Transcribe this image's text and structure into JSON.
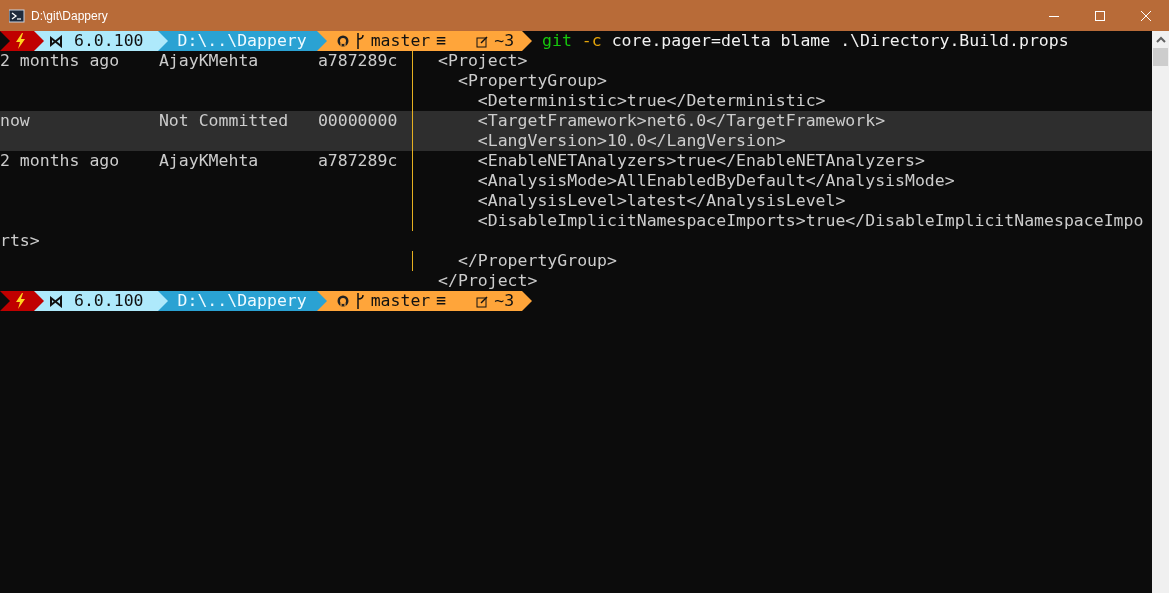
{
  "window": {
    "title": "D:\\git\\Dappery"
  },
  "command_prompt": {
    "segments": [
      {
        "kind": "status"
      },
      {
        "kind": "dotnet",
        "text": "6.0.100"
      },
      {
        "kind": "path",
        "text": "D:\\..\\Dappery"
      },
      {
        "kind": "git",
        "branch": "master",
        "status": "≡",
        "changes": "~3"
      }
    ],
    "command": [
      {
        "kind": "program",
        "text": "git"
      },
      {
        "kind": "flag",
        "text": "-c"
      },
      {
        "kind": "arg",
        "text": "core.pager=delta blame .\\Directory.Build.props"
      }
    ]
  },
  "blame": {
    "lines": [
      {
        "kind": "blame",
        "date": "2 months ago",
        "author": "AjayKMehta",
        "commit": "a787289c",
        "code": "<Project>",
        "uncommitted": false
      },
      {
        "kind": "blame",
        "code": "  <PropertyGroup>",
        "uncommitted": false
      },
      {
        "kind": "blame",
        "code": "    <Deterministic>true</Deterministic>",
        "uncommitted": false
      },
      {
        "kind": "blame",
        "date": "now",
        "author": "Not Committed",
        "commit": "00000000",
        "code": "    <TargetFramework>net6.0</TargetFramework>",
        "uncommitted": true
      },
      {
        "kind": "blame",
        "code": "    <LangVersion>10.0</LangVersion>",
        "uncommitted": true
      },
      {
        "kind": "blame",
        "date": "2 months ago",
        "author": "AjayKMehta",
        "commit": "a787289c",
        "code": "    <EnableNETAnalyzers>true</EnableNETAnalyzers>",
        "uncommitted": false
      },
      {
        "kind": "blame",
        "code": "    <AnalysisMode>AllEnabledByDefault</AnalysisMode>",
        "uncommitted": false
      },
      {
        "kind": "blame",
        "code": "    <AnalysisLevel>latest</AnalysisLevel>",
        "uncommitted": false
      },
      {
        "kind": "blame",
        "code": "    <DisableImplicitNamespaceImports>true</DisableImplicitNamespaceImpo",
        "uncommitted": false
      },
      {
        "kind": "wrap",
        "code": "rts>",
        "uncommitted": false
      },
      {
        "kind": "blame",
        "code": "  </PropertyGroup>",
        "uncommitted": false
      },
      {
        "kind": "tail",
        "code": "</Project>",
        "uncommitted": false
      }
    ]
  },
  "prompt": {
    "segments": [
      {
        "kind": "status"
      },
      {
        "kind": "dotnet",
        "text": "6.0.100"
      },
      {
        "kind": "path",
        "text": "D:\\..\\Dappery"
      },
      {
        "kind": "git",
        "branch": "master",
        "status": "≡",
        "changes": "~3"
      }
    ]
  }
}
